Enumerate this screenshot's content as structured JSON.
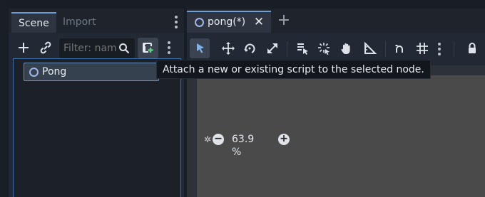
{
  "scene_dock": {
    "tabs": [
      {
        "label": "Scene",
        "active": true
      },
      {
        "label": "Import",
        "active": false
      }
    ],
    "toolbar": {
      "add_icon": "plus-icon",
      "link_icon": "link-icon",
      "filter_placeholder": "Filter: nam",
      "search_icon": "search-icon",
      "attach_icon": "attach-script-icon",
      "more_icon": "vertical-dots-icon"
    },
    "tree": {
      "items": [
        {
          "label": "Pong",
          "icon": "node-icon",
          "selected": true
        }
      ]
    }
  },
  "editor": {
    "tabs": [
      {
        "label": "pong(*)",
        "icon": "node-icon",
        "close_icon": "close-icon"
      }
    ],
    "new_tab_icon": "plus-icon",
    "toolbar_icons": [
      "select-arrow-icon",
      "move-icon",
      "rotate-icon",
      "scale-icon",
      "list-select-icon",
      "pivot-icon",
      "pan-hand-icon",
      "ruler-icon",
      "snap-icon",
      "grid-icon",
      "vertical-dots-icon",
      "lock-icon"
    ],
    "viewport": {
      "zoom_value": "63.9 %",
      "zoom_minus": "−",
      "zoom_plus": "+"
    }
  },
  "tooltip": {
    "text": "Attach a new or existing script to the selected node."
  },
  "colors": {
    "accent": "#6f9fd6",
    "panel_bg": "#232934",
    "viewport_bg": "#4a4a4a",
    "select_icon": "#7fb0e8"
  }
}
